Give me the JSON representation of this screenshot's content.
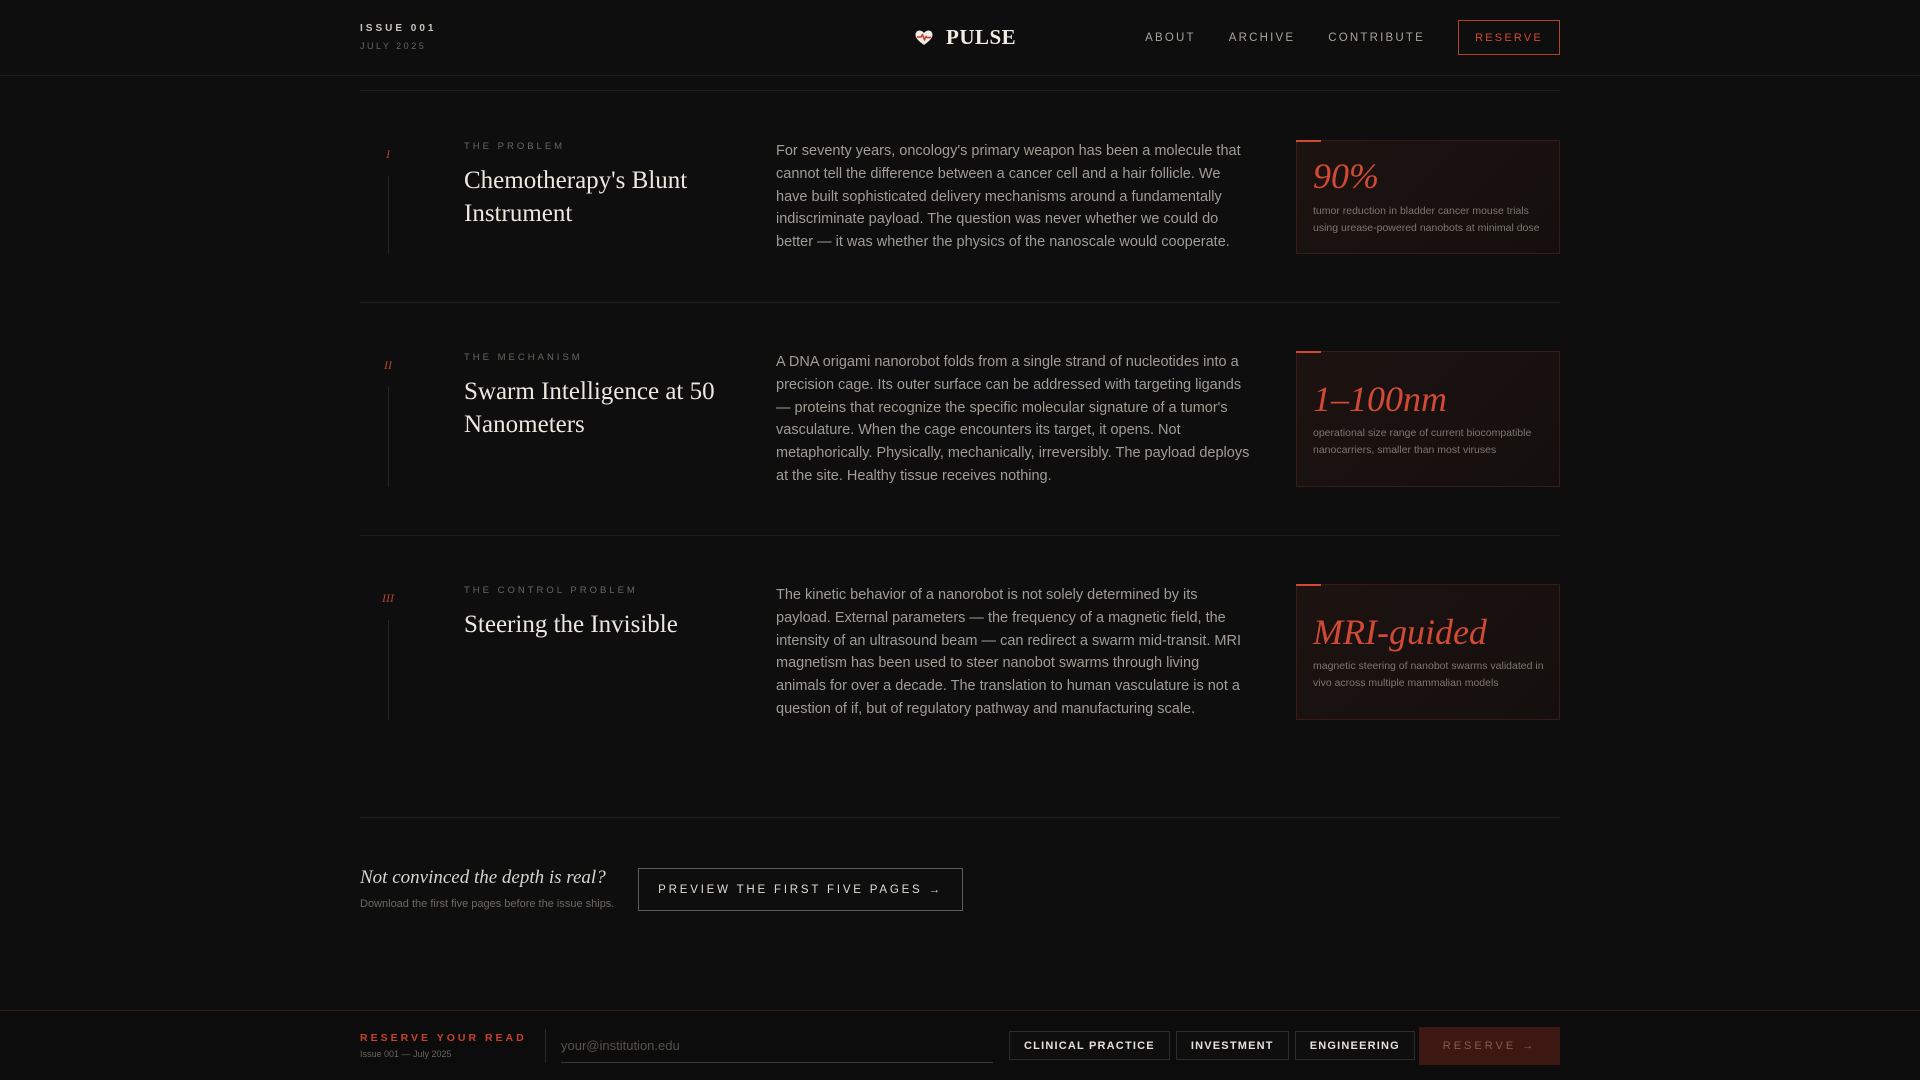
{
  "header": {
    "issue_label": "ISSUE 001",
    "issue_date": "JULY 2025",
    "logo_text": "PULSE",
    "nav": [
      "ABOUT",
      "ARCHIVE",
      "CONTRIBUTE"
    ],
    "reserve_label": "RESERVE"
  },
  "sections": [
    {
      "numeral": "I",
      "kicker": "THE PROBLEM",
      "title": "Chemotherapy's Blunt Instrument",
      "body": "For seventy years, oncology's primary weapon has been a molecule that cannot tell the difference between a cancer cell and a hair follicle. We have built sophisticated delivery mechanisms around a fundamentally indiscriminate payload. The question was never whether we could do better — it was whether the physics of the nanoscale would cooperate.",
      "stat_value": "90%",
      "stat_desc": "tumor reduction in bladder cancer mouse trials using urease-powered nanobots at minimal dose"
    },
    {
      "numeral": "II",
      "kicker": "THE MECHANISM",
      "title": "Swarm Intelligence at 50 Nanometers",
      "body": "A DNA origami nanorobot folds from a single strand of nucleotides into a precision cage. Its outer surface can be addressed with targeting ligands — proteins that recognize the specific molecular signature of a tumor's vasculature. When the cage encounters its target, it opens. Not metaphorically. Physically, mechanically, irreversibly. The payload deploys at the site. Healthy tissue receives nothing.",
      "stat_value": "1–100nm",
      "stat_desc": "operational size range of current biocompatible nanocarriers, smaller than most viruses"
    },
    {
      "numeral": "III",
      "kicker": "THE CONTROL PROBLEM",
      "title": "Steering the Invisible",
      "body": "The kinetic behavior of a nanorobot is not solely determined by its payload. External parameters — the frequency of a magnetic field, the intensity of an ultrasound beam — can redirect a swarm mid-transit. MRI magnetism has been used to steer nanobot swarms through living animals for over a decade. The translation to human vasculature is not a question of if, but of regulatory pathway and manufacturing scale.",
      "stat_value": "MRI-guided",
      "stat_desc": "magnetic steering of nanobot swarms validated in vivo across multiple mammalian models"
    }
  ],
  "cta": {
    "question": "Not convinced the depth is real?",
    "sub": "Download the first five pages before the issue ships.",
    "button": "PREVIEW THE FIRST FIVE PAGES →"
  },
  "footer": {
    "label": "RESERVE YOUR READ",
    "sub": "Issue 001 — July 2025",
    "email_placeholder": "your@institution.edu",
    "chips": [
      "CLINICAL PRACTICE",
      "INVESTMENT",
      "ENGINEERING"
    ],
    "reserve_button": "RESERVE →"
  },
  "colors": {
    "accent": "#d24a35",
    "background": "#0e0e0e",
    "reserve_button_bg": "#3d1712"
  },
  "icons": {
    "logo": "heart-pulse-icon"
  }
}
